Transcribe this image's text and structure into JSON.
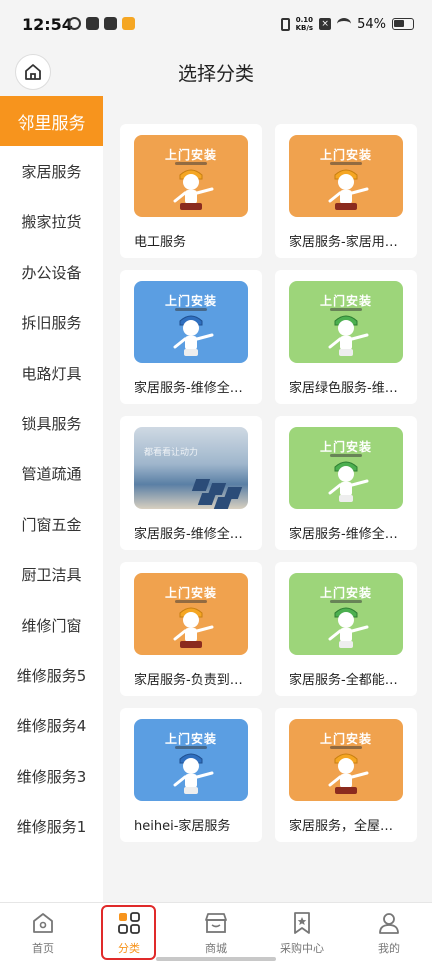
{
  "status_bar": {
    "time": "12:54",
    "speed_top": "0.10",
    "speed_bottom": "KB/s",
    "battery": "54%"
  },
  "header": {
    "title": "选择分类"
  },
  "sidebar": {
    "items": [
      {
        "label": "邻里服务",
        "active": true
      },
      {
        "label": "家居服务"
      },
      {
        "label": "搬家拉货"
      },
      {
        "label": "办公设备"
      },
      {
        "label": "拆旧服务"
      },
      {
        "label": "电路灯具"
      },
      {
        "label": "锁具服务"
      },
      {
        "label": "管道疏通"
      },
      {
        "label": "门窗五金"
      },
      {
        "label": "厨卫洁具"
      },
      {
        "label": "维修门窗"
      },
      {
        "label": "维修服务5"
      },
      {
        "label": "维修服务4"
      },
      {
        "label": "维修服务3"
      },
      {
        "label": "维修服务1"
      }
    ]
  },
  "grid": {
    "thumb_title": "上门安装",
    "photo_text": "都看看让动力",
    "cards": [
      {
        "label": "电工服务",
        "color": "orange"
      },
      {
        "label": "家居服务-家居用…",
        "color": "orange"
      },
      {
        "label": "家居服务-维修全…",
        "color": "blue"
      },
      {
        "label": "家居绿色服务-维…",
        "color": "green"
      },
      {
        "label": "家居服务-维修全…",
        "color": "photo"
      },
      {
        "label": "家居服务-维修全…",
        "color": "green"
      },
      {
        "label": "家居服务-负责到…",
        "color": "orange"
      },
      {
        "label": "家居服务-全都能…",
        "color": "green"
      },
      {
        "label": "heihei-家居服务",
        "color": "blue"
      },
      {
        "label": "家居服务，全屋…",
        "color": "orange"
      }
    ]
  },
  "tabbar": {
    "tabs": [
      {
        "label": "首页",
        "icon": "home-icon"
      },
      {
        "label": "分类",
        "icon": "category-icon",
        "active": true
      },
      {
        "label": "商城",
        "icon": "store-icon"
      },
      {
        "label": "采购中心",
        "icon": "bookmark-icon"
      },
      {
        "label": "我的",
        "icon": "user-icon"
      }
    ]
  },
  "colors": {
    "accent": "#f7941d",
    "highlight": "#e02a2a"
  }
}
